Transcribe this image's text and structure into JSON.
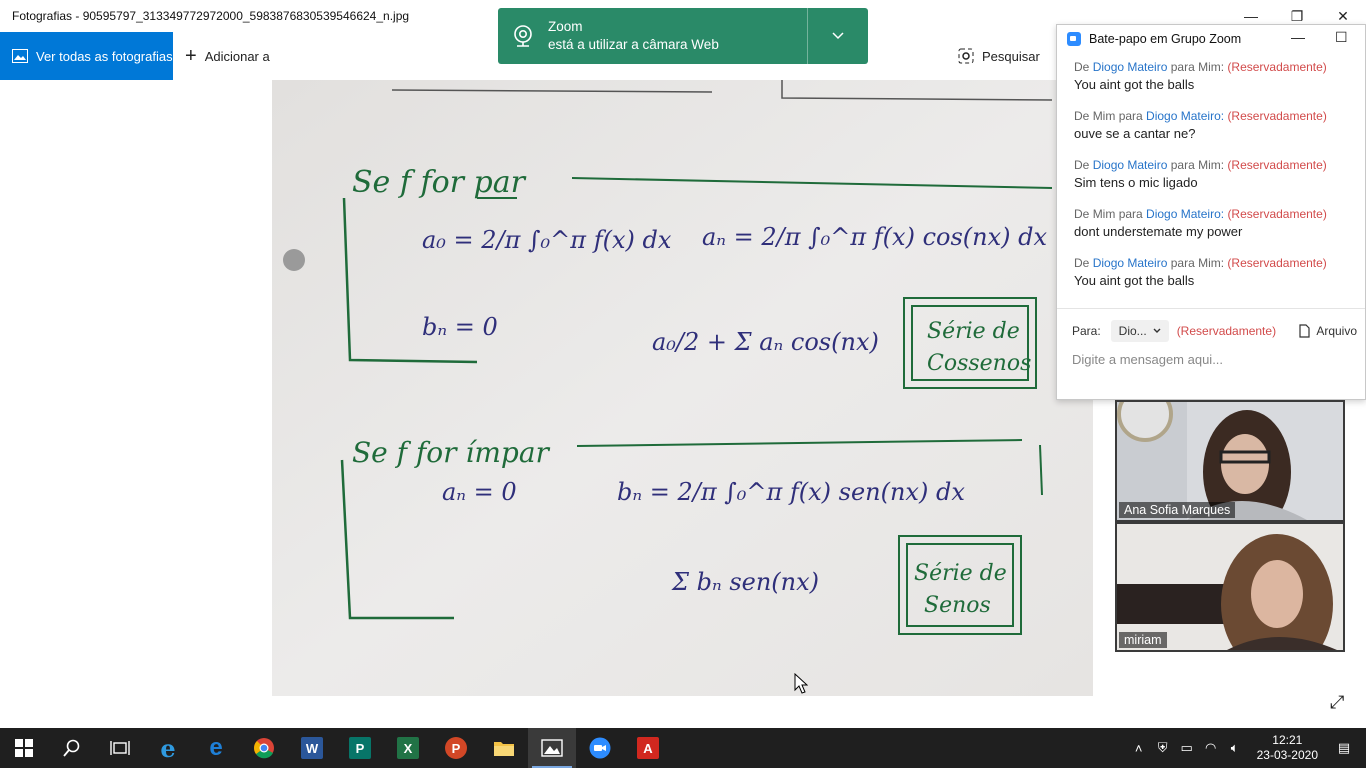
{
  "window": {
    "title": "Fotografias - 90595797_313349772972000_5983876830539546624_n.jpg",
    "controls": {
      "minimize": "—",
      "restore": "❐",
      "close": "✕"
    }
  },
  "toolbar": {
    "view_all_label": "Ver todas as fotografias",
    "add_label": "Adicionar a",
    "search_label": "Pesquisar"
  },
  "toast": {
    "title": "Zoom",
    "message": "está a utilizar a câmara Web"
  },
  "photo": {
    "even_heading": "Se f for par",
    "a0": "a₀ = 2/π ∫₀^π f(x) dx",
    "an": "aₙ = 2/π ∫₀^π f(x) cos(nx) dx",
    "bn_zero": "bₙ = 0",
    "cos_series": "a₀/2 + Σ aₙ cos(nx)",
    "cos_box": [
      "Série de",
      "Cossenos"
    ],
    "odd_heading": "Se f for ímpar",
    "an_zero": "aₙ = 0",
    "bn": "bₙ = 2/π ∫₀^π f(x) sen(nx) dx",
    "sin_series": "Σ bₙ sen(nx)",
    "sin_box": [
      "Série de",
      "Senos"
    ]
  },
  "chat": {
    "title": "Bate-papo em Grupo Zoom",
    "messages": [
      {
        "prefix": "De ",
        "from": "Diogo Mateiro",
        "mid": " para ",
        "to": "Mim:",
        "privacy": "(Reservadamente)",
        "text": "You aint got the balls",
        "from_is_link": true
      },
      {
        "prefix": "De ",
        "from": "Mim",
        "mid": " para ",
        "to": "Diogo Mateiro:",
        "privacy": "(Reservadamente)",
        "text": "ouve se a cantar ne?",
        "from_is_link": false
      },
      {
        "prefix": "De ",
        "from": "Diogo Mateiro",
        "mid": " para ",
        "to": "Mim:",
        "privacy": "(Reservadamente)",
        "text": "Sim tens o mic ligado",
        "from_is_link": true
      },
      {
        "prefix": "De ",
        "from": "Mim",
        "mid": " para ",
        "to": "Diogo Mateiro:",
        "privacy": "(Reservadamente)",
        "text": "dont understemate my power",
        "from_is_link": false
      },
      {
        "prefix": "De ",
        "from": "Diogo Mateiro",
        "mid": " para ",
        "to": "Mim:",
        "privacy": "(Reservadamente)",
        "text": "You aint got the balls",
        "from_is_link": true
      }
    ],
    "to_label": "Para:",
    "to_value": "Dio...",
    "to_privacy": "(Reservadamente)",
    "file_label": "Arquivo",
    "input_placeholder": "Digite a mensagem aqui..."
  },
  "videos": [
    {
      "name": "Ana Sofia Marques"
    },
    {
      "name": "miriam"
    }
  ],
  "taskbar": {
    "apps": [
      "start",
      "search",
      "task-view",
      "internet-explorer",
      "edge",
      "chrome",
      "word",
      "publisher",
      "excel",
      "powerpoint",
      "file-explorer",
      "photos",
      "zoom",
      "acrobat"
    ],
    "time": "12:21",
    "date": "23-03-2020"
  },
  "colors": {
    "accent": "#0078d7",
    "toast": "#2a8a68",
    "chat_link": "#2774c9",
    "chat_private": "#d24b4b",
    "ink_green": "#1f6b3a",
    "ink_blue": "#2f2f7a"
  }
}
